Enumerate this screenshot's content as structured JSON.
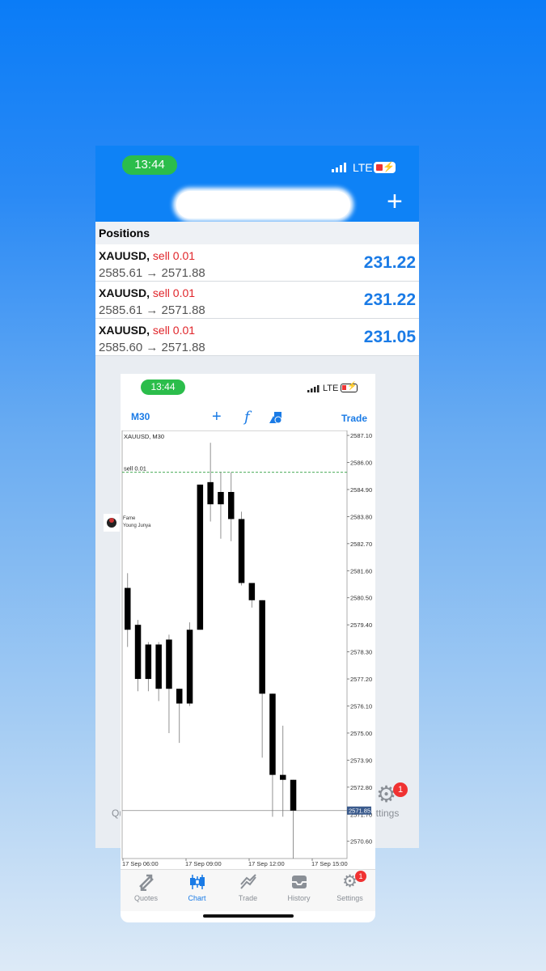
{
  "back_screen": {
    "status": {
      "time": "13:44",
      "network": "LTE"
    },
    "header": {
      "add_label": "+"
    },
    "positions_title": "Positions",
    "positions": [
      {
        "symbol": "XAUUSD,",
        "side": "sell 0.01",
        "prices": "2585.61 → 2571.88",
        "profit": "231.22"
      },
      {
        "symbol": "XAUUSD,",
        "side": "sell 0.01",
        "prices": "2585.61 → 2571.88",
        "profit": "231.22"
      },
      {
        "symbol": "XAUUSD,",
        "side": "sell 0.01",
        "prices": "2585.60 → 2571.88",
        "profit": "231.05"
      }
    ],
    "tabs": {
      "quotes_partial": "Qu",
      "settings_partial": "ettings",
      "settings_badge": "1"
    }
  },
  "front_screen": {
    "status": {
      "time": "13:44",
      "network": "LTE"
    },
    "toolbar": {
      "timeframe": "M30",
      "trade": "Trade"
    },
    "chart_label": "XAUUSD, M30",
    "order_line_label": "sell 0.01",
    "current_price": "2571.85",
    "watermark": {
      "name": "Fame",
      "sub": "Young Junya"
    },
    "tabs": [
      {
        "label": "Quotes",
        "icon": "quotes-icon"
      },
      {
        "label": "Chart",
        "icon": "chart-icon"
      },
      {
        "label": "Trade",
        "icon": "trade-icon"
      },
      {
        "label": "History",
        "icon": "history-icon"
      },
      {
        "label": "Settings",
        "icon": "gear-icon"
      }
    ],
    "settings_badge": "1"
  },
  "chart_data": {
    "type": "candlestick",
    "title": "XAUUSD, M30",
    "y_ticks": [
      "2587.10",
      "2586.00",
      "2584.90",
      "2583.80",
      "2582.70",
      "2581.60",
      "2580.50",
      "2579.40",
      "2578.30",
      "2577.20",
      "2576.10",
      "2575.00",
      "2573.90",
      "2572.80",
      "2571.70",
      "2570.60"
    ],
    "x_ticks": [
      "17 Sep 06:00",
      "17 Sep 09:00",
      "17 Sep 12:00",
      "17 Sep 15:00"
    ],
    "ylim": [
      2569.9,
      2587.3
    ],
    "order_line": 2585.6,
    "current_price": 2571.85,
    "candles": [
      {
        "o": 2579.2,
        "h": 2581.5,
        "l": 2578.5,
        "c": 2580.9
      },
      {
        "o": 2579.4,
        "h": 2579.6,
        "l": 2576.7,
        "c": 2577.2
      },
      {
        "o": 2577.2,
        "h": 2578.7,
        "l": 2576.7,
        "c": 2578.6
      },
      {
        "o": 2578.6,
        "h": 2578.7,
        "l": 2576.3,
        "c": 2576.8
      },
      {
        "o": 2578.8,
        "h": 2579.0,
        "l": 2575.0,
        "c": 2576.8
      },
      {
        "o": 2576.8,
        "h": 2576.8,
        "l": 2574.6,
        "c": 2576.2
      },
      {
        "o": 2576.2,
        "h": 2579.5,
        "l": 2576.1,
        "c": 2579.2
      },
      {
        "o": 2579.2,
        "h": 2585.1,
        "l": 2579.2,
        "c": 2585.1
      },
      {
        "o": 2585.2,
        "h": 2586.8,
        "l": 2583.6,
        "c": 2584.3
      },
      {
        "o": 2584.3,
        "h": 2585.6,
        "l": 2582.9,
        "c": 2584.8
      },
      {
        "o": 2584.8,
        "h": 2585.6,
        "l": 2582.8,
        "c": 2583.7
      },
      {
        "o": 2583.7,
        "h": 2584.0,
        "l": 2581.0,
        "c": 2581.1
      },
      {
        "o": 2581.1,
        "h": 2581.1,
        "l": 2580.1,
        "c": 2580.4
      },
      {
        "o": 2580.4,
        "h": 2580.4,
        "l": 2574.0,
        "c": 2576.6
      },
      {
        "o": 2576.6,
        "h": 2576.6,
        "l": 2571.6,
        "c": 2573.3
      },
      {
        "o": 2573.3,
        "h": 2575.3,
        "l": 2571.6,
        "c": 2573.1
      },
      {
        "o": 2573.1,
        "h": 2573.1,
        "l": 2569.9,
        "c": 2571.85
      }
    ]
  },
  "colors": {
    "accent": "#1a7be6",
    "sell": "#e0252a",
    "status_pill": "#2bbd4b",
    "badge": "#f03232",
    "order_line": "#2e9e3e"
  }
}
